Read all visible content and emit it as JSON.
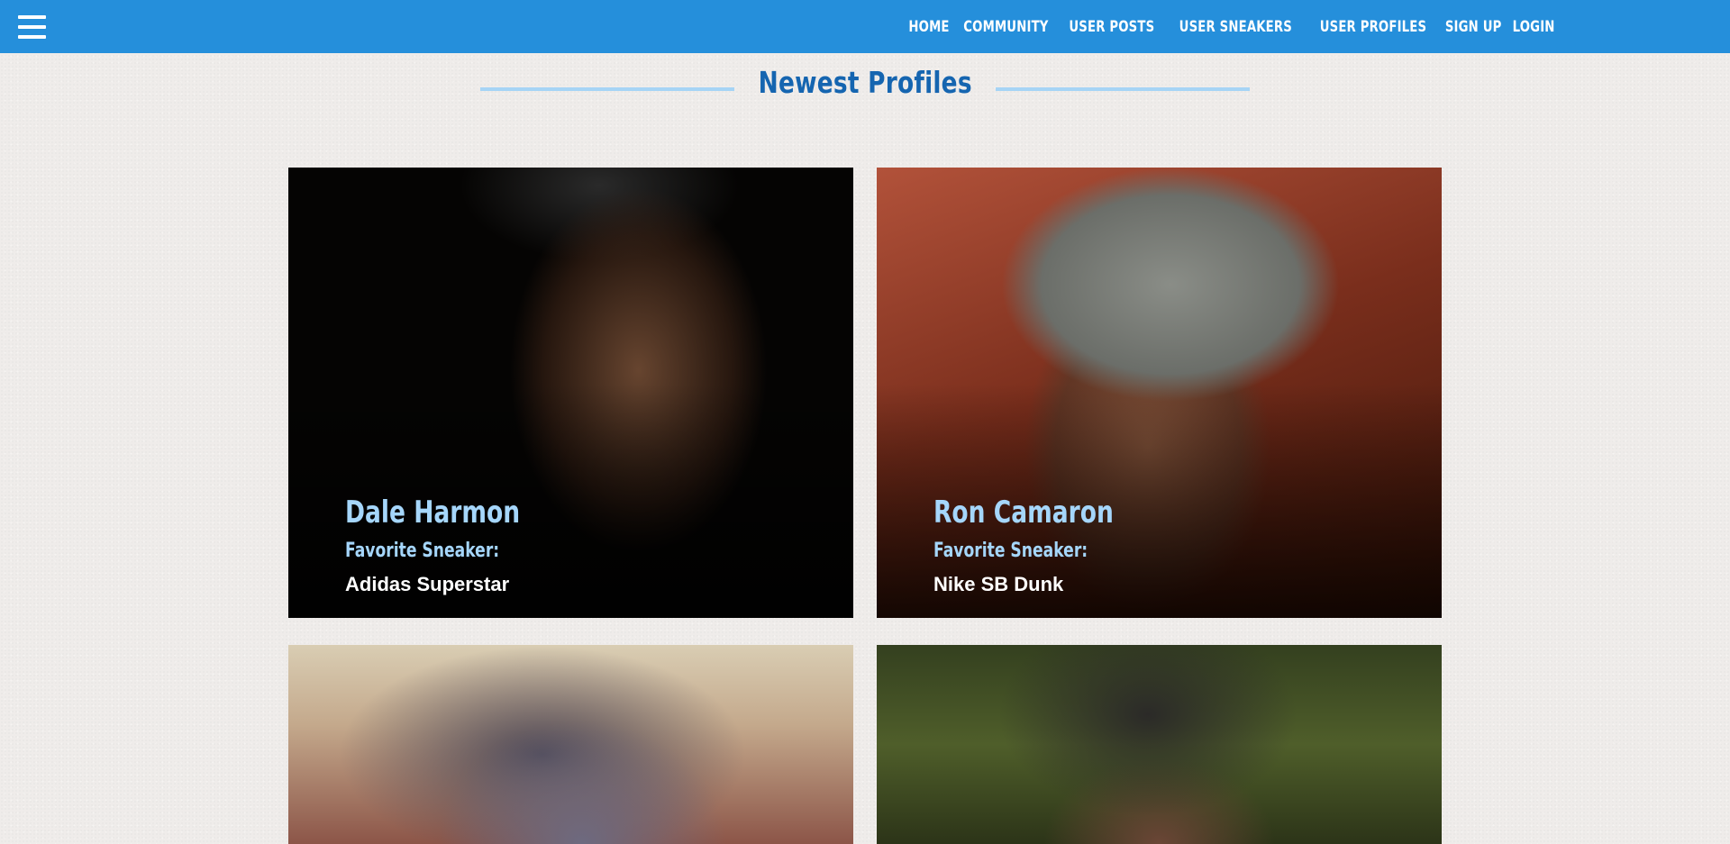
{
  "nav": {
    "items": [
      "HOME",
      "COMMUNITY",
      "USER POSTS",
      "USER SNEAKERS",
      "USER PROFILES",
      "SIGN UP",
      "LOGIN"
    ]
  },
  "colors": {
    "navbar": "#258fdb",
    "title": "#1565b0",
    "rule": "#a6d4f5",
    "accent_text": "#a5d6fb"
  },
  "section": {
    "title": "Newest Profiles"
  },
  "profiles": [
    {
      "name": "Dale Harmon",
      "fav_label": "Favorite Sneaker:",
      "fav_value": "Adidas Superstar"
    },
    {
      "name": "Ron Camaron",
      "fav_label": "Favorite Sneaker:",
      "fav_value": "Nike SB Dunk"
    },
    {
      "name": "",
      "fav_label": "",
      "fav_value": ""
    },
    {
      "name": "",
      "fav_label": "",
      "fav_value": ""
    }
  ]
}
